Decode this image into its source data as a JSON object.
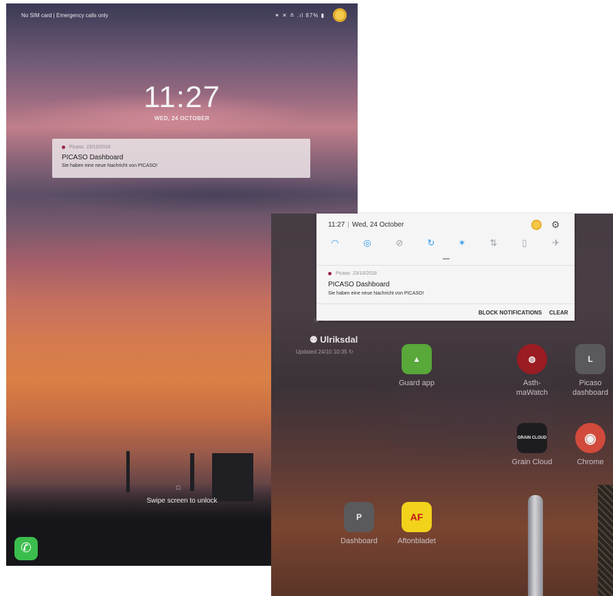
{
  "lock_screen": {
    "status_bar": {
      "carrier": "No SIM card | Emergency calls only",
      "system_text": "✶ ✕ ≗ .ıl 87% ▮"
    },
    "clock": "11:27",
    "date": "WED, 24 OCTOBER",
    "notification": {
      "app": "Picaso",
      "date": "23/10/2018",
      "title": "PICASO Dashboard",
      "body": "Sie haben eine neue Nachricht von PICASO!"
    },
    "unlock_hint": "Swipe screen to unlock",
    "phone_icon": "✆"
  },
  "notification_panel": {
    "time": "11:27",
    "separator": "|",
    "date": "Wed, 24 October",
    "settings_icon": "⚙",
    "quick_settings": [
      {
        "icon": "wifi-icon",
        "glyph": "◠",
        "color": "#2f9cf0"
      },
      {
        "icon": "location-icon",
        "glyph": "◎",
        "color": "#2f9cf0"
      },
      {
        "icon": "mute-icon",
        "glyph": "⊘",
        "color": "#9aa0a6"
      },
      {
        "icon": "auto-rotate-icon",
        "glyph": "↻",
        "color": "#2f9cf0"
      },
      {
        "icon": "bluetooth-icon",
        "glyph": "✶",
        "color": "#2f9cf0"
      },
      {
        "icon": "data-transfer-icon",
        "glyph": "⇅",
        "color": "#9aa0a6"
      },
      {
        "icon": "power-saving-icon",
        "glyph": "▯",
        "color": "#9aa0a6"
      },
      {
        "icon": "airplane-mode-icon",
        "glyph": "✈",
        "color": "#9aa0a6"
      }
    ],
    "notification": {
      "app": "Picaso",
      "date": "23/10/2018",
      "title": "PICASO Dashboard",
      "body": "Sie haben eine neue Nachricht von PICASO!"
    },
    "actions": {
      "block": "BLOCK NOTIFICATIONS",
      "clear": "CLEAR"
    }
  },
  "home_screen": {
    "weather": {
      "location": "⚉ Ulriksdal",
      "updated": "Updated 24/10 10:35 ↻"
    },
    "apps": [
      {
        "name": "guard-app",
        "label": "Guard app",
        "glyph": "▲",
        "bg": "#58a83a"
      },
      {
        "name": "asthmawatch",
        "label": "Asth-\nmaWatch",
        "glyph": "◍",
        "bg": "#9b1c22"
      },
      {
        "name": "picaso-dashboard",
        "label": "Picaso\ndashboard",
        "glyph": "L",
        "bg": "#5a5a5c"
      },
      {
        "name": "grain-cloud",
        "label": "Grain Cloud",
        "glyph": "GRAIN CLOUD",
        "bg": "#1d1d1f"
      },
      {
        "name": "chrome",
        "label": "Chrome",
        "glyph": "◉",
        "bg": "#d24a3b"
      },
      {
        "name": "dashboard",
        "label": "Dashboard",
        "glyph": "P",
        "bg": "#5a5a5c"
      },
      {
        "name": "aftonbladet",
        "label": "Aftonbladet",
        "glyph": "AF",
        "bg": "#f2d21b"
      }
    ]
  }
}
